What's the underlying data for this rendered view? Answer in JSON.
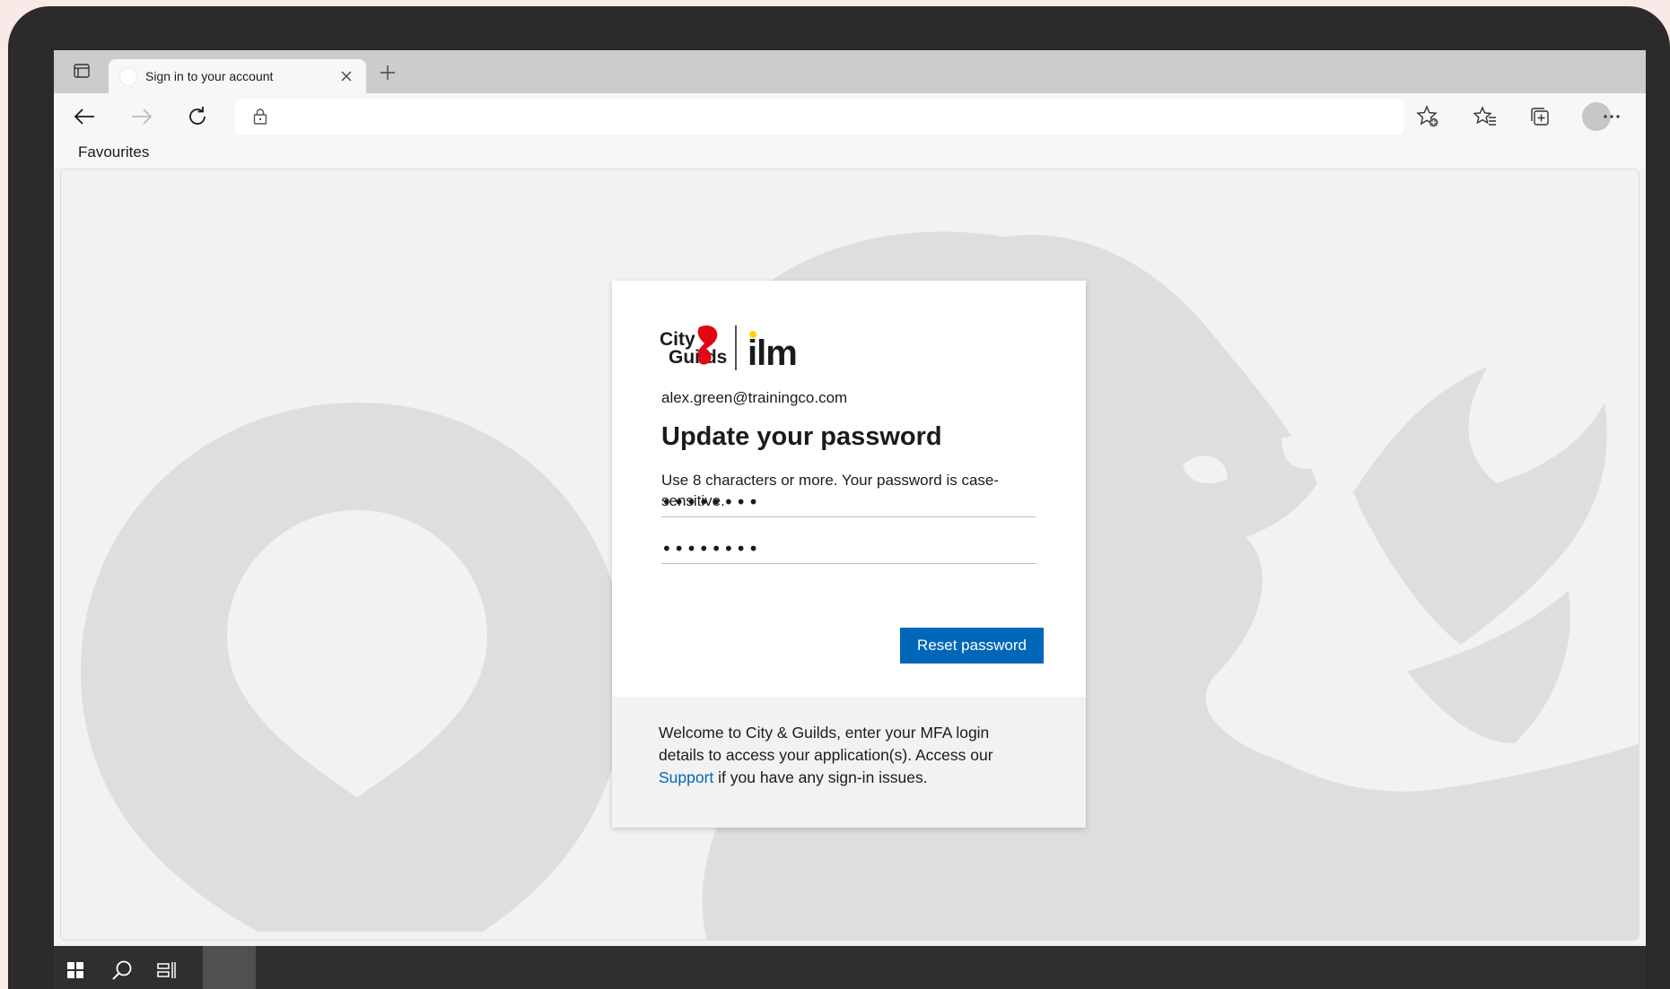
{
  "browser": {
    "tab_title": "Sign in to your account",
    "favourites_label": "Favourites"
  },
  "signin": {
    "identity": "alex.green@trainingco.com",
    "heading": "Update your password",
    "description": "Use 8 characters or more. Your password is case-sensitive.",
    "new_password_value": "••••••••",
    "confirm_password_value": "••••••••",
    "reset_button": "Reset password",
    "footer_before": "Welcome to City & Guilds, enter your MFA login details to access your application(s). Access our",
    "footer_link": "Support",
    "footer_after": "if you have any sign-in issues."
  },
  "logo": {
    "city_text": "City",
    "guilds_text": "Guilds",
    "ilm_text": "ilm"
  },
  "colors": {
    "accent": "#0067b8",
    "logo_red": "#e30613",
    "ilm_dot": "#ffd200"
  },
  "icons": {
    "tab_actions": "tab-actions-icon",
    "close": "close-icon",
    "new_tab": "plus-icon",
    "back": "back-arrow-icon",
    "forward": "forward-arrow-icon",
    "refresh": "refresh-icon",
    "lock": "lock-icon",
    "add_favourite": "star-add-icon",
    "favourites": "favourites-icon",
    "collections": "collections-icon",
    "profile": "profile-avatar",
    "more": "more-icon",
    "start": "windows-start-icon",
    "search": "search-icon",
    "task_view": "task-view-icon"
  }
}
